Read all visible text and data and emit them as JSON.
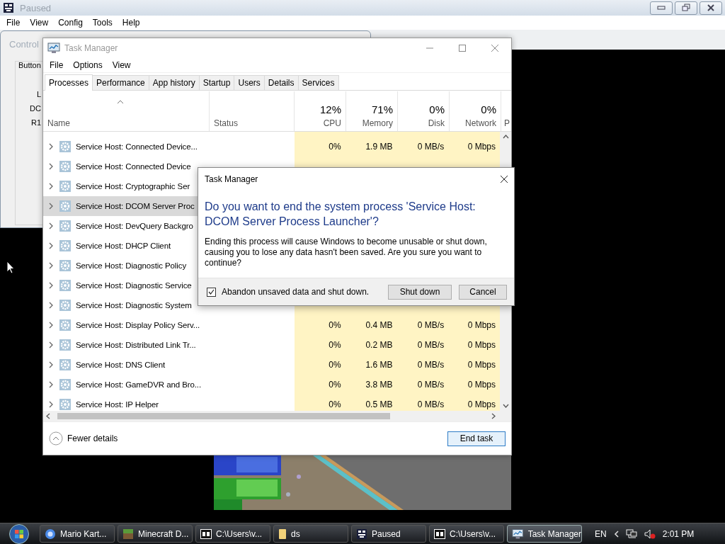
{
  "emulator_window": {
    "title": "Paused",
    "menu": [
      "File",
      "View",
      "Config",
      "Tools",
      "Help"
    ]
  },
  "control_config_window": {
    "title": "Control",
    "group_label": "Button",
    "labels": [
      "L",
      "DC",
      "R1"
    ]
  },
  "task_manager": {
    "title": "Task Manager",
    "menu": [
      "File",
      "Options",
      "View"
    ],
    "tabs": [
      {
        "label": "Processes",
        "selected": true
      },
      {
        "label": "Performance",
        "selected": false
      },
      {
        "label": "App history",
        "selected": false
      },
      {
        "label": "Startup",
        "selected": false
      },
      {
        "label": "Users",
        "selected": false
      },
      {
        "label": "Details",
        "selected": false
      },
      {
        "label": "Services",
        "selected": false
      }
    ],
    "name_column": "Name",
    "status_column": "Status",
    "usage_columns": [
      {
        "percent": "12%",
        "label": "CPU"
      },
      {
        "percent": "71%",
        "label": "Memory"
      },
      {
        "percent": "0%",
        "label": "Disk"
      },
      {
        "percent": "0%",
        "label": "Network"
      }
    ],
    "cut_column": "P",
    "rows": [
      {
        "name": "Service Host: Connected Device...",
        "selected": false,
        "values": [
          "0%",
          "1.9 MB",
          "0 MB/s",
          "0 Mbps"
        ]
      },
      {
        "name": "Service Host: Connected Device",
        "selected": false
      },
      {
        "name": "Service Host: Cryptographic Ser",
        "selected": false
      },
      {
        "name": "Service Host: DCOM Server Proc",
        "selected": true
      },
      {
        "name": "Service Host: DevQuery Backgro",
        "selected": false
      },
      {
        "name": "Service Host: DHCP Client",
        "selected": false
      },
      {
        "name": "Service Host: Diagnostic Policy",
        "selected": false
      },
      {
        "name": "Service Host: Diagnostic Service",
        "selected": false
      },
      {
        "name": "Service Host: Diagnostic System",
        "selected": false
      },
      {
        "name": "Service Host: Display Policy Serv...",
        "selected": false,
        "values": [
          "0%",
          "0.4 MB",
          "0 MB/s",
          "0 Mbps"
        ]
      },
      {
        "name": "Service Host: Distributed Link Tr...",
        "selected": false,
        "values": [
          "0%",
          "0.2 MB",
          "0 MB/s",
          "0 Mbps"
        ]
      },
      {
        "name": "Service Host: DNS Client",
        "selected": false,
        "values": [
          "0%",
          "1.6 MB",
          "0 MB/s",
          "0 Mbps"
        ]
      },
      {
        "name": "Service Host: GameDVR and Bro...",
        "selected": false,
        "values": [
          "0%",
          "3.8 MB",
          "0 MB/s",
          "0 Mbps"
        ]
      },
      {
        "name": "Service Host: IP Helper",
        "selected": false,
        "values": [
          "0%",
          "0.5 MB",
          "0 MB/s",
          "0 Mbps"
        ]
      }
    ],
    "details_toggle": "Fewer details",
    "end_task_button": "End task"
  },
  "dialog": {
    "title": "Task Manager",
    "heading": "Do you want to end the system process 'Service Host: DCOM Server Process Launcher'?",
    "message": "Ending this process will cause Windows to become unusable or shut down, causing you to lose any data hasn't been saved. Are you sure you want to continue?",
    "checkbox": {
      "label": "Abandon unsaved data and shut down.",
      "checked": true
    },
    "buttons": [
      "Shut down",
      "Cancel"
    ]
  },
  "taskbar": {
    "items": [
      {
        "label": "Mario Kart...",
        "kind": "browser",
        "selected": false
      },
      {
        "label": "Minecraft D...",
        "kind": "block",
        "selected": false
      },
      {
        "label": "C:\\Users\\v...",
        "kind": "archive",
        "selected": false
      },
      {
        "label": "ds",
        "kind": "folder",
        "selected": false
      },
      {
        "label": "Paused",
        "kind": "emulator",
        "selected": false
      },
      {
        "label": "C:\\Users\\v...",
        "kind": "archive",
        "selected": false
      },
      {
        "label": "Task Manager",
        "kind": "monitor",
        "selected": true
      }
    ],
    "language": "EN",
    "clock": "2:01 PM"
  }
}
